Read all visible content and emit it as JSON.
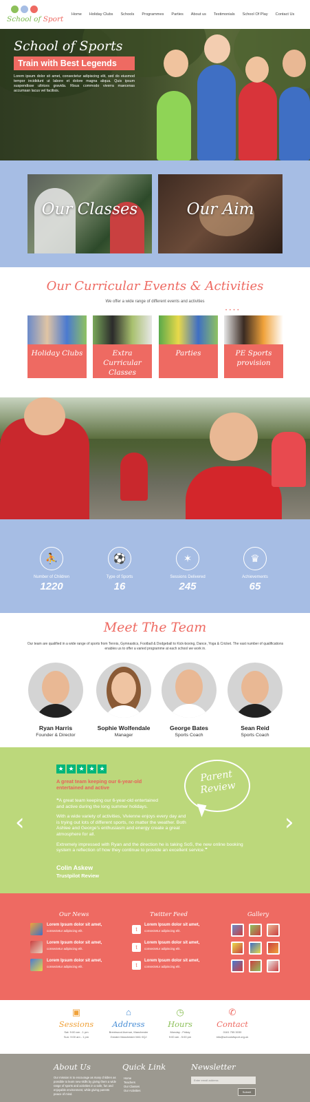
{
  "header": {
    "logo_line1": "School of",
    "logo_line2": "Sport",
    "nav": [
      "Home",
      "Holiday Clubs",
      "Schools",
      "Programmes",
      "Parties",
      "About us",
      "Testimonials",
      "School Of Play",
      "Contact Us"
    ]
  },
  "hero": {
    "title": "School of Sports",
    "tagline": "Train with Best Legends",
    "body": "Lorem ipsum dolor sit amet, consectetur adipiscing elit, sed do eiusmod tempor incididunt ut labore et dolore magna aliqua. Quis ipsum suspendisse ultrices gravida. Risus commodo viverra maecenas accumsan lacus vel facilisis."
  },
  "feature_cards": [
    "Our Classes",
    "Our Aim"
  ],
  "events": {
    "title": "Our Curricular Events & Activities",
    "subtitle": "We offer a wide range of different events and activities",
    "dots": "• • • •",
    "items": [
      "Holiday Clubs",
      "Extra Curricular Classes",
      "Parties",
      "PE Sports provision"
    ]
  },
  "stats": [
    {
      "label": "Number of Children",
      "value": "1220",
      "icon": "running-icon"
    },
    {
      "label": "Type of Sports",
      "value": "16",
      "icon": "sports-balls-icon"
    },
    {
      "label": "Sessions Delivered",
      "value": "245",
      "icon": "stretching-icon"
    },
    {
      "label": "Achievements",
      "value": "65",
      "icon": "trophy-icon"
    }
  ],
  "team": {
    "title": "Meet The Team",
    "subtitle": "Our team are qualified in a wide range of sports from Tennis, Gymnastics, Football & Dodgeball to Kick-boxing, Dance, Yoga & Cricket. The vast number of qualifications enables us to offer a varied programme at each school we work in.",
    "members": [
      {
        "name": "Ryan Harris",
        "role": "Founder & Director"
      },
      {
        "name": "Sophie Wolfendale",
        "role": "Manager"
      },
      {
        "name": "George Bates",
        "role": "Sports Coach"
      },
      {
        "name": "Sean Reid",
        "role": "Sports Coach"
      }
    ]
  },
  "review": {
    "stars": "★",
    "headline": "A great team keeping our 6-year-old entertained and active",
    "body1": "❝A great team keeping our 6-year-old entertained and active during the long summer holidays.",
    "body2": "With a wide variety of activities, Vivienne enjoys every day and is trying out lots of different sports, no matter the weather. Both Ashlee and George's enthusiasm and energy create a great atmosphere for all.",
    "body3": "Extremely impressed with Ryan and the direction he is taking SoS, the new online booking system a reflection of how they continue to provide an excellent service.❞",
    "author": "Colin Askew",
    "source": "Trustpilot Review",
    "bubble": "Parent Review",
    "prev": "‹",
    "next": "›"
  },
  "footer_cols": {
    "news_title": "Our News",
    "twitter_title": "Twitter Feed",
    "gallery_title": "Gallery",
    "item_title": "Lorem Ipsum dolor sit amet,",
    "item_sub": "consectetur adipiscing elit.",
    "twitter_glyph": "t"
  },
  "info": [
    {
      "title": "Sessions",
      "color": "#f0a23a",
      "icon": "briefcase-icon",
      "glyph": "▣",
      "lines": [
        "Sat: 9:00 am - 1 pm",
        "Sun: 9:00 am - 1 pm"
      ]
    },
    {
      "title": "Address",
      "color": "#4a8fd6",
      "icon": "map-pin-icon",
      "glyph": "⌂",
      "lines": [
        "Brentwood Avenue, Manchester",
        "Greater Manchester M41 0QJ"
      ]
    },
    {
      "title": "Hours",
      "color": "#8dc05a",
      "icon": "clock-icon",
      "glyph": "◷",
      "lines": [
        "Monday - Friday",
        "9:00 am - 5:00 pm"
      ]
    },
    {
      "title": "Contact",
      "color": "#ee6a62",
      "icon": "phone-icon",
      "glyph": "✆",
      "lines": [
        "0161 755 3030",
        "info@schoolofsport.org.uk"
      ]
    }
  ],
  "bottom": {
    "about_title": "About Us",
    "about_text": "Our mission is to encourage as many children as possible to learn new skills by giving them a wide range of sports and activities in a safe, fun and enjoyable environment, while giving parents peace of mind.",
    "links_title": "Quick Link",
    "links": [
      "Home",
      "Teachers",
      "Our Classes",
      "Our Activities"
    ],
    "newsletter_title": "Newsletter",
    "email_placeholder": "Enter email address",
    "submit": "Submit"
  }
}
